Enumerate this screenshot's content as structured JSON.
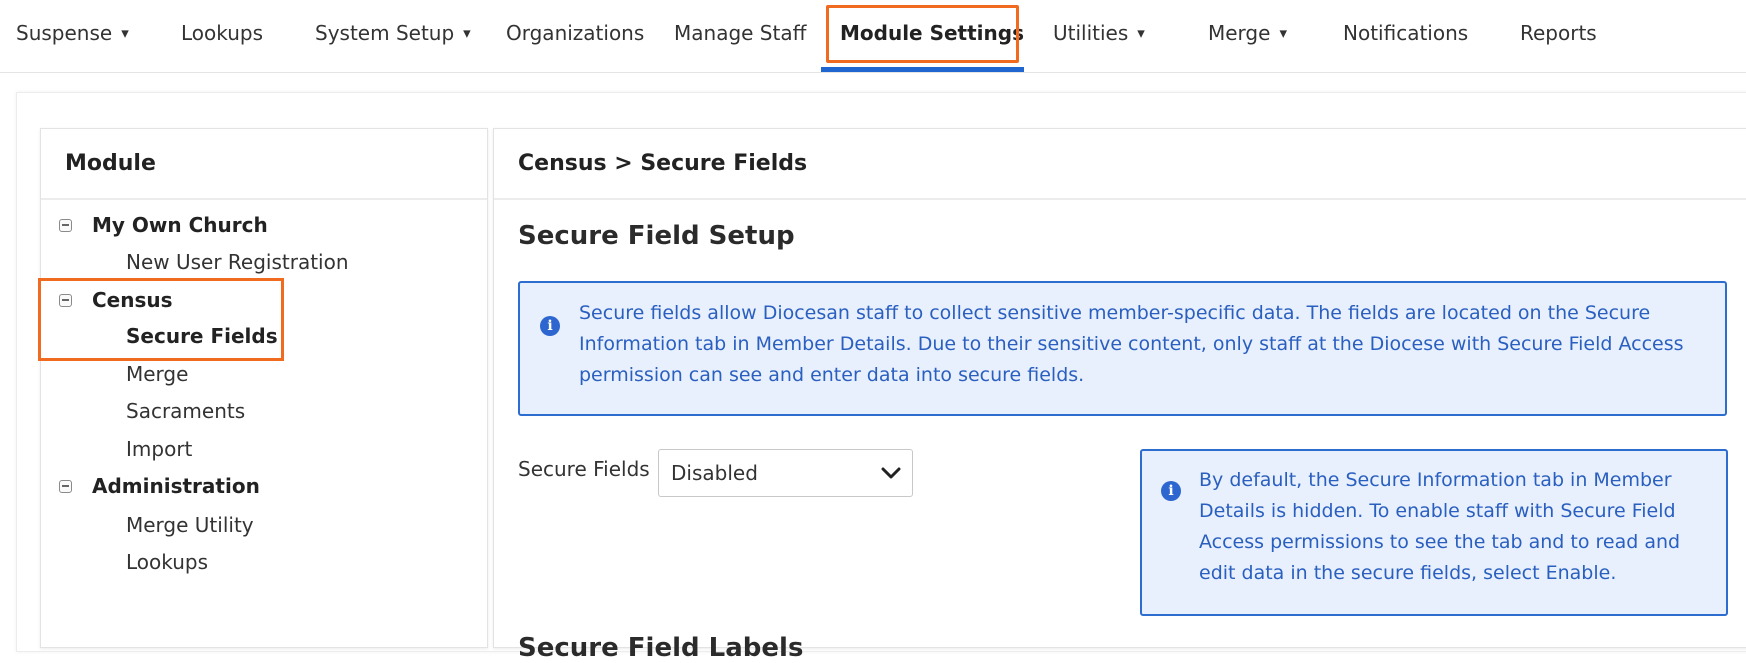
{
  "nav": {
    "items": [
      {
        "label": "Suspense",
        "caret": "▾"
      },
      {
        "label": "Lookups"
      },
      {
        "label": "System Setup",
        "caret": "▾"
      },
      {
        "label": "Organizations"
      },
      {
        "label": "Manage Staff"
      },
      {
        "label": "Module Settings",
        "active": true
      },
      {
        "label": "Utilities",
        "caret": "▾"
      },
      {
        "label": "Merge",
        "caret": "▾"
      },
      {
        "label": "Notifications"
      },
      {
        "label": "Reports"
      }
    ]
  },
  "module_panel": {
    "title": "Module",
    "groups": [
      {
        "label": "My Own Church",
        "items": [
          "New User Registration"
        ]
      },
      {
        "label": "Census",
        "items": [
          "Secure Fields",
          "Merge",
          "Sacraments",
          "Import"
        ],
        "selected": "Secure Fields"
      },
      {
        "label": "Administration",
        "items": [
          "Merge Utility",
          "Lookups"
        ]
      }
    ]
  },
  "content": {
    "breadcrumb": "Census > Secure Fields",
    "title": "Secure Field Setup",
    "info_main": "Secure fields allow Diocesan staff to collect sensitive member-specific data. The fields are located on the Secure Information tab in Member Details. Due to their sensitive content, only staff at the Diocese with Secure Field Access permission can see and enter data into secure fields.",
    "field_label": "Secure Fields",
    "field_value": "Disabled",
    "info_side": "By default, the Secure Information tab in Member Details is hidden. To enable staff with Secure Field Access permissions to see the tab and to read and edit data in the secure fields, select Enable.",
    "next_heading": "Secure Field Labels"
  },
  "colors": {
    "accent_blue": "#1f66d1",
    "highlight_orange": "#f06a20",
    "info_bg": "#e7f0fc",
    "info_text": "#2a5fc0"
  },
  "icons": {
    "info": "info-circle-icon",
    "collapse": "minus-square-icon",
    "dropdown": "chevron-down-icon"
  }
}
